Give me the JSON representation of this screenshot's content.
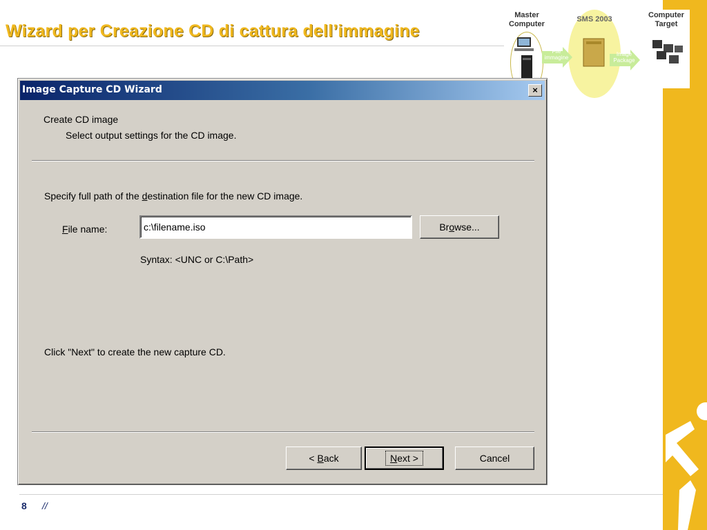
{
  "slide": {
    "title": "Wizard per Creazione CD di cattura dell’immagine",
    "page_number": "8",
    "footer_mark": "//"
  },
  "process": {
    "master_label": "Master Computer",
    "sms_label": "SMS 2003",
    "target_label": "Computer Target",
    "arrow1_label": "File immagine",
    "arrow2_label": "Image Package",
    "ellipse_color": "#f7f3a0",
    "arrow_color": "#c8ec9a"
  },
  "dialog": {
    "title": "Image Capture CD Wizard",
    "close_glyph": "×",
    "header_title": "Create CD image",
    "header_subtitle": "Select output settings for the CD image.",
    "instruction_before": "Specify full path of the ",
    "instruction_key": "d",
    "instruction_after": "estination file for the new CD image.",
    "file_label_key": "F",
    "file_label_rest": "ile name:",
    "file_value": "c:\\filename.iso",
    "browse_pre": "Br",
    "browse_key": "o",
    "browse_post": "wse...",
    "syntax": "Syntax: <UNC or C:\\Path>",
    "next_hint": "Click \"Next\" to create the new capture CD.",
    "back_pre": "< ",
    "back_key": "B",
    "back_post": "ack",
    "next_key": "N",
    "next_post": "ext >",
    "cancel": "Cancel"
  },
  "colors": {
    "brand_yellow": "#f0b81e",
    "title_blue": "#0a246a",
    "dialog_gray": "#d4d0c8"
  }
}
